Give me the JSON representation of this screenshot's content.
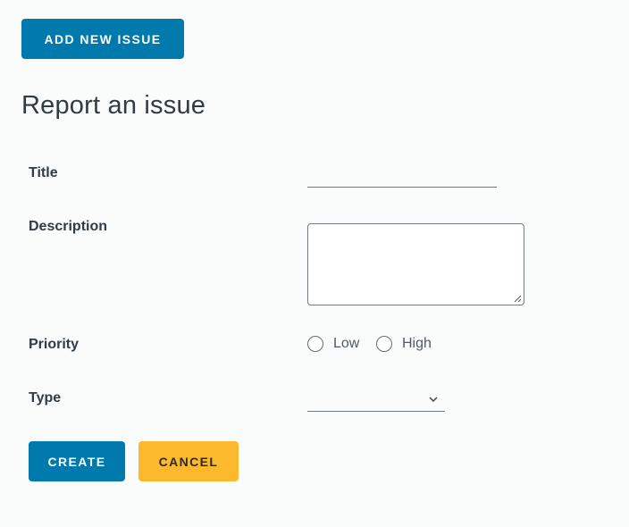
{
  "toolbar": {
    "add_new_label": "ADD NEW ISSUE"
  },
  "form": {
    "heading": "Report an issue",
    "title": {
      "label": "Title",
      "value": ""
    },
    "description": {
      "label": "Description",
      "value": ""
    },
    "priority": {
      "label": "Priority",
      "options": [
        "Low",
        "High"
      ],
      "selected": null
    },
    "type": {
      "label": "Type",
      "value": "",
      "icon": "chevron-down-icon"
    }
  },
  "actions": {
    "create_label": "CREATE",
    "cancel_label": "CANCEL"
  },
  "colors": {
    "primary": "#0079ad",
    "warning": "#fdb92e",
    "text": "#313b42",
    "background": "#fafcfc"
  }
}
